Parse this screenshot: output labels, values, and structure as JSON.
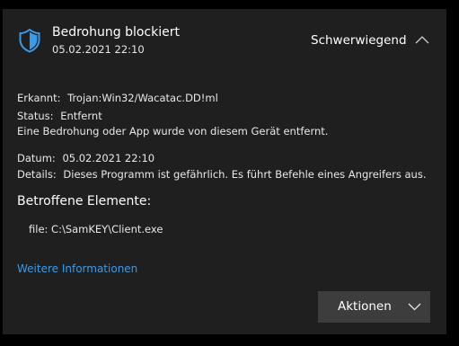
{
  "header": {
    "title": "Bedrohung blockiert",
    "date": "05.02.2021 22:10",
    "severity": "Schwerwiegend",
    "shield_icon": "shield-icon",
    "collapse_icon": "chevron-up-icon"
  },
  "details": {
    "detected_label": "Erkannt:",
    "detected_value": "Trojan:Win32/Wacatac.DD!ml",
    "status_label": "Status:",
    "status_value": "Entfernt",
    "description": "Eine Bedrohung oder App wurde von diesem Gerät entfernt.",
    "date_label": "Datum:",
    "date_value": "05.02.2021 22:10",
    "details_label": "Details:",
    "details_value": "Dieses Programm ist gefährlich. Es führt Befehle eines Angreifers aus."
  },
  "affected": {
    "title": "Betroffene Elemente:",
    "items": [
      "file: C:\\SamKEY\\Client.exe"
    ]
  },
  "more_info_link": "Weitere Informationen",
  "actions_button": {
    "label": "Aktionen",
    "icon": "chevron-down-icon"
  },
  "colors": {
    "background": "#000000",
    "panel": "#1f1f1f",
    "accent_blue": "#3a9be8",
    "button": "#3d3d3d"
  }
}
